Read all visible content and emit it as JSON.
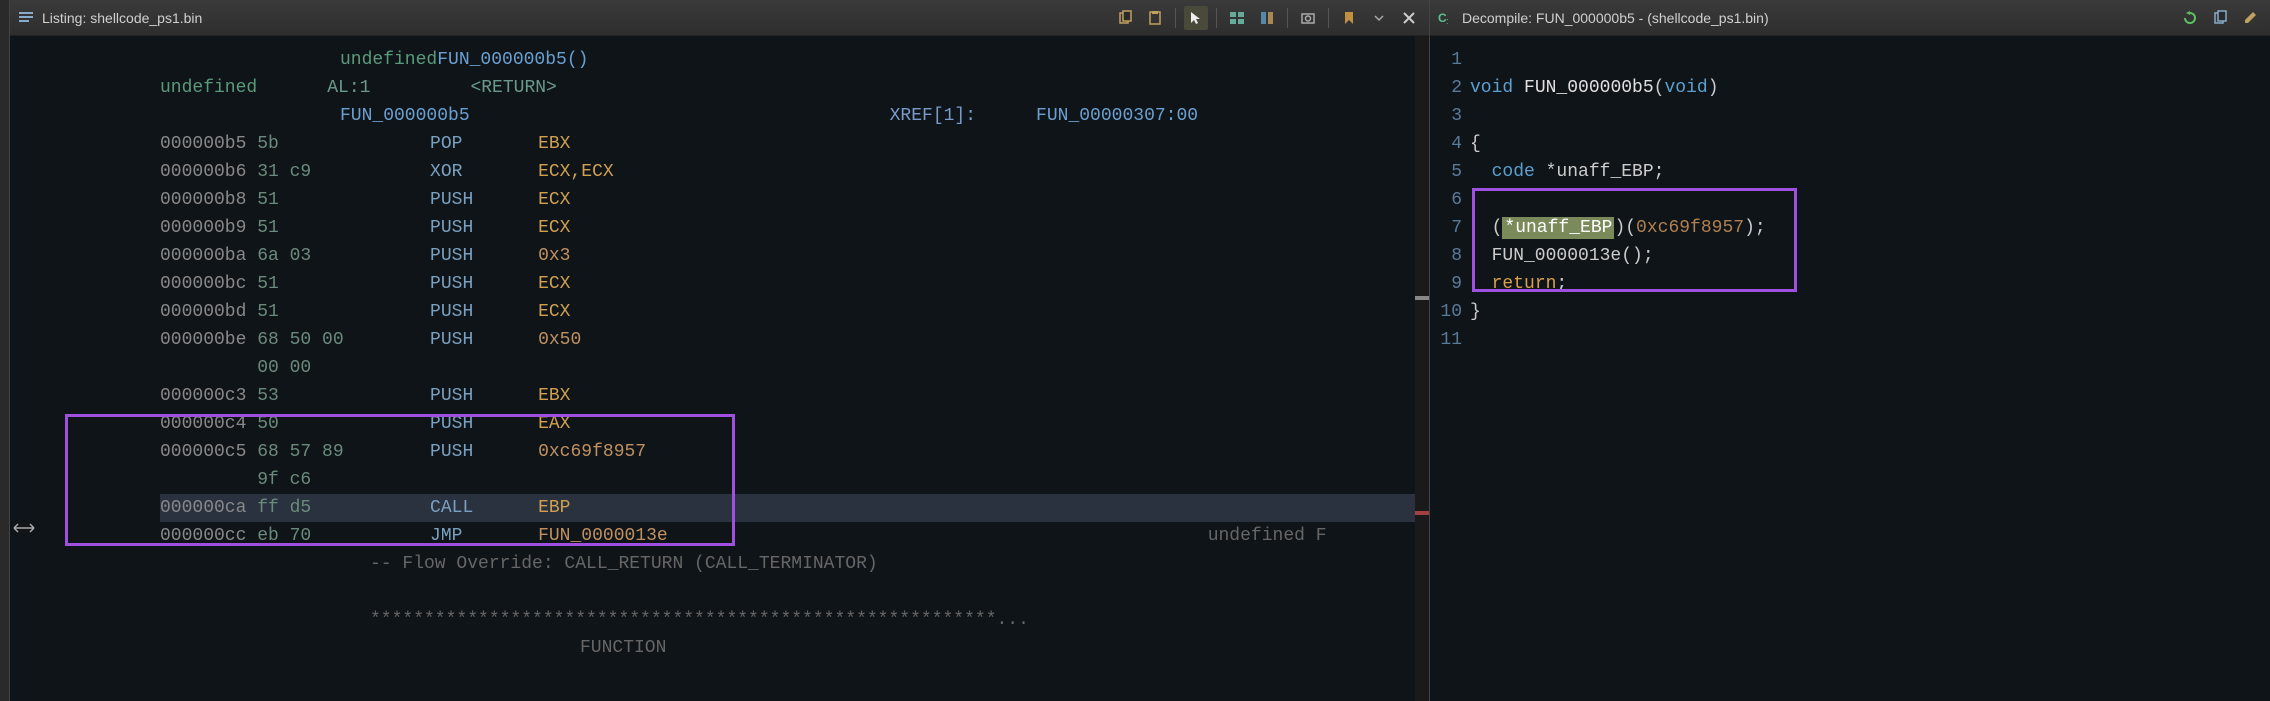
{
  "listing": {
    "title": "Listing:  shellcode_ps1.bin",
    "header_return_type": "undefined",
    "header_fn": "FUN_000000b5()",
    "header_ret_kw": "undefined",
    "header_al": "AL:1",
    "header_return": "<RETURN>",
    "header_label": "FUN_000000b5",
    "xref_label": "XREF[1]:",
    "xref_target": "FUN_00000307:00",
    "rows": [
      {
        "addr": "000000b5",
        "bytes": "5b",
        "mnem": "POP",
        "opnd": "EBX"
      },
      {
        "addr": "000000b6",
        "bytes": "31 c9",
        "mnem": "XOR",
        "opnd": "ECX,ECX"
      },
      {
        "addr": "000000b8",
        "bytes": "51",
        "mnem": "PUSH",
        "opnd": "ECX"
      },
      {
        "addr": "000000b9",
        "bytes": "51",
        "mnem": "PUSH",
        "opnd": "ECX"
      },
      {
        "addr": "000000ba",
        "bytes": "6a 03",
        "mnem": "PUSH",
        "opnd": "0x3"
      },
      {
        "addr": "000000bc",
        "bytes": "51",
        "mnem": "PUSH",
        "opnd": "ECX"
      },
      {
        "addr": "000000bd",
        "bytes": "51",
        "mnem": "PUSH",
        "opnd": "ECX"
      },
      {
        "addr": "000000be",
        "bytes": "68 50 00",
        "mnem": "PUSH",
        "opnd": "0x50"
      },
      {
        "addr": "",
        "bytes": "00 00",
        "mnem": "",
        "opnd": ""
      },
      {
        "addr": "000000c3",
        "bytes": "53",
        "mnem": "PUSH",
        "opnd": "EBX"
      },
      {
        "addr": "000000c4",
        "bytes": "50",
        "mnem": "PUSH",
        "opnd": "EAX"
      },
      {
        "addr": "000000c5",
        "bytes": "68 57 89",
        "mnem": "PUSH",
        "opnd": "0xc69f8957"
      },
      {
        "addr": "",
        "bytes": "9f c6",
        "mnem": "",
        "opnd": ""
      },
      {
        "addr": "000000ca",
        "bytes": "ff d5",
        "mnem": "CALL",
        "opnd": "EBP",
        "hl": true
      },
      {
        "addr": "000000cc",
        "bytes": "eb 70",
        "mnem": "JMP",
        "opnd": "FUN_0000013e",
        "tail": "undefined F"
      }
    ],
    "flow_comment": "-- Flow Override: CALL_RETURN (CALL_TERMINATOR)",
    "stars": "**********************************************************...",
    "func_footer": "FUNCTION"
  },
  "decompile": {
    "title": "Decompile: FUN_000000b5 -  (shellcode_ps1.bin)",
    "lines": [
      {
        "n": "1",
        "t": ""
      },
      {
        "n": "2",
        "t": "void FUN_000000b5(void)",
        "sig": true
      },
      {
        "n": "3",
        "t": ""
      },
      {
        "n": "4",
        "t": "{"
      },
      {
        "n": "5",
        "t": "  code *unaff_EBP;",
        "decl": true
      },
      {
        "n": "6",
        "t": ""
      },
      {
        "n": "7",
        "t": "  (*unaff_EBP)(0xc69f8957);",
        "call": true
      },
      {
        "n": "8",
        "t": "  FUN_0000013e();"
      },
      {
        "n": "9",
        "t": "  return;"
      },
      {
        "n": "10",
        "t": "}"
      },
      {
        "n": "11",
        "t": ""
      }
    ]
  },
  "icons": {
    "listing": "listing-icon",
    "decompile": "decompile-icon"
  }
}
